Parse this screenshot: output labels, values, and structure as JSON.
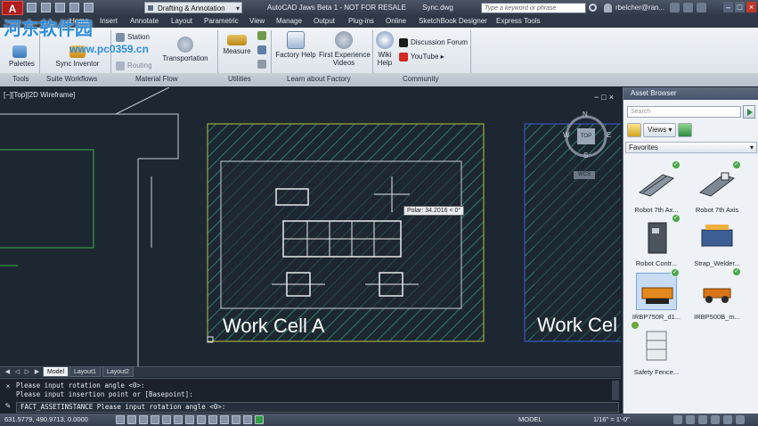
{
  "titlebar": {
    "app_button": "A",
    "workspace": "Drafting & Annotation",
    "title": "AutoCAD Jaws Beta 1 - NOT FOR RESALE",
    "file": "Sync.dwg",
    "search_placeholder": "Type a keyword or phrase",
    "user": "rbelcher@ran...",
    "icons": [
      "new-icon",
      "open-icon",
      "save-icon",
      "undo-icon",
      "redo-icon",
      "search-icon",
      "user-icon",
      "help-icon"
    ]
  },
  "ribbon_tabs": [
    "Home",
    "Insert",
    "Annotate",
    "Layout",
    "Parametric",
    "View",
    "Manage",
    "Output",
    "Plug-ins",
    "Online",
    "SketchBook Designer",
    "Express Tools"
  ],
  "ribbon": {
    "tools": {
      "button": "Palettes",
      "group": "Tools"
    },
    "suite": {
      "button": "Sync Inventor",
      "group": "Suite Workflows"
    },
    "material": {
      "station": "Station",
      "routing": "Routing",
      "transportation": "Transportation",
      "group": "Material Flow"
    },
    "utilities": {
      "measure": "Measure",
      "group": "Utilities"
    },
    "learn": {
      "factory_help": "Factory Help",
      "first_experience": "First Experience",
      "videos": "Videos",
      "group": "Learn about Factory"
    },
    "community": {
      "wiki": "Wiki",
      "help": "Help",
      "discussion": "Discussion Forum",
      "youtube": "YouTube",
      "group": "Community"
    }
  },
  "watermark": {
    "brand": "河东软件园",
    "url": "www.pc0359.cn"
  },
  "viewport": {
    "label": "[−][Top][2D Wireframe]",
    "controls": [
      "−",
      "□",
      "×"
    ],
    "nav": {
      "n": "N",
      "s": "S",
      "w": "W",
      "e": "E",
      "cube": "TOP",
      "wcs": "WCS"
    },
    "polar_tooltip": "Polar: 34.2016 < 0°",
    "work_cell_a": "Work Cell A",
    "work_cell_b": "Work Cel"
  },
  "layout_tabs": [
    "Model",
    "Layout1",
    "Layout2"
  ],
  "command": {
    "history": [
      "Please input rotation angle <0>:",
      "Please input insertion point or [Basepoint]:"
    ],
    "input": "FACT_ASSETINSTANCE Please input rotation angle <0>:",
    "icons": [
      "close-icon",
      "wrench-icon"
    ]
  },
  "status": {
    "coords": "631.5779, 490.9713, 0.0000",
    "model": "MODEL",
    "scale": "1/16\" = 1'-0\"",
    "colors": {
      "plus": "#2ea043"
    }
  },
  "asset_browser": {
    "title": "Asset Browser",
    "search_placeholder": "Search",
    "views": "Views",
    "category": "Favorites",
    "items": [
      {
        "name": "Robot 7th Ax...",
        "thumb": "rail-icon"
      },
      {
        "name": "Robot 7th Axis",
        "thumb": "rail-icon"
      },
      {
        "name": "Robot Contr...",
        "thumb": "cabinet-icon"
      },
      {
        "name": "Strap_Welder...",
        "thumb": "welder-icon"
      },
      {
        "name": "IRBP750R_d1...",
        "thumb": "positioner-icon"
      },
      {
        "name": "IRBP500B_m...",
        "thumb": "positioner-icon"
      },
      {
        "name": "Safety Fence...",
        "thumb": "fence-icon"
      }
    ]
  }
}
